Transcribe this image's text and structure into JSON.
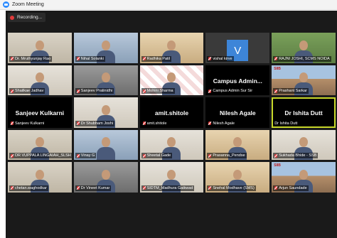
{
  "window": {
    "title": "Zoom Meeting"
  },
  "recording": {
    "label": "Recording..."
  },
  "tiles": [
    {
      "name": "Dr. Mruthyunjay Rao",
      "muted": true,
      "kind": "video",
      "bg": "bg-office"
    },
    {
      "name": "Nihal Solanki",
      "muted": true,
      "kind": "video",
      "bg": "bg-blue"
    },
    {
      "name": "Radhika Patil",
      "muted": true,
      "kind": "video",
      "bg": "bg-warm"
    },
    {
      "name": "vishal kirve",
      "muted": true,
      "kind": "avatar",
      "initial": "V"
    },
    {
      "name": "RAJNI JOSHI, SCMS NOIDA",
      "muted": true,
      "kind": "video",
      "bg": "bg-green"
    },
    {
      "name": "Shailkae Jadhav",
      "muted": true,
      "kind": "video",
      "bg": "bg-room"
    },
    {
      "name": "Sanjeev Pratinidhi",
      "muted": true,
      "kind": "video",
      "bg": "bg-grey"
    },
    {
      "name": "Mohini Sharma",
      "muted": true,
      "kind": "video",
      "bg": "bg-red"
    },
    {
      "name": "Campus Admin Sur Sir",
      "muted": true,
      "kind": "name",
      "display": "Campus Admin..."
    },
    {
      "name": "Prashant Sarkar",
      "muted": true,
      "kind": "video",
      "bg": "bg-building",
      "badge": "SIIB"
    },
    {
      "name": "Sanjeev Kulkarni",
      "muted": true,
      "kind": "name",
      "display": "Sanjeev Kulkarni"
    },
    {
      "name": "Dr Shubham Joshi",
      "muted": true,
      "kind": "video",
      "bg": "bg-room"
    },
    {
      "name": "amit.shitole",
      "muted": true,
      "kind": "name",
      "display": "amit.shitole"
    },
    {
      "name": "Nilesh Agale",
      "muted": true,
      "kind": "name",
      "display": "Nilesh Agale"
    },
    {
      "name": "Dr Ishita Dutt",
      "muted": false,
      "kind": "name",
      "display": "Dr Ishita Dutt",
      "active": true
    },
    {
      "name": "DR VUPPALA LINGAIAH_SLSH",
      "muted": true,
      "kind": "video",
      "bg": "bg-office"
    },
    {
      "name": "Vinay G",
      "muted": true,
      "kind": "video",
      "bg": "bg-blue"
    },
    {
      "name": "Sheetal Gade",
      "muted": true,
      "kind": "video",
      "bg": "bg-room"
    },
    {
      "name": "Prasanna_Pendse",
      "muted": true,
      "kind": "video",
      "bg": "bg-warm"
    },
    {
      "name": "Sukhada Bhide - SSB",
      "muted": true,
      "kind": "video",
      "bg": "bg-room"
    },
    {
      "name": "chetan.waghodkar",
      "muted": true,
      "kind": "video",
      "bg": "bg-office"
    },
    {
      "name": "Dr Vineet Kumar",
      "muted": true,
      "kind": "video",
      "bg": "bg-grey"
    },
    {
      "name": "SIDTM_Madhura Gaikwad",
      "muted": true,
      "kind": "video",
      "bg": "bg-room"
    },
    {
      "name": "Snehal Modhave (SMS)",
      "muted": true,
      "kind": "video",
      "bg": "bg-warm"
    },
    {
      "name": "Arjun Saundade",
      "muted": true,
      "kind": "video",
      "bg": "bg-building",
      "badge": "SIIB"
    }
  ]
}
